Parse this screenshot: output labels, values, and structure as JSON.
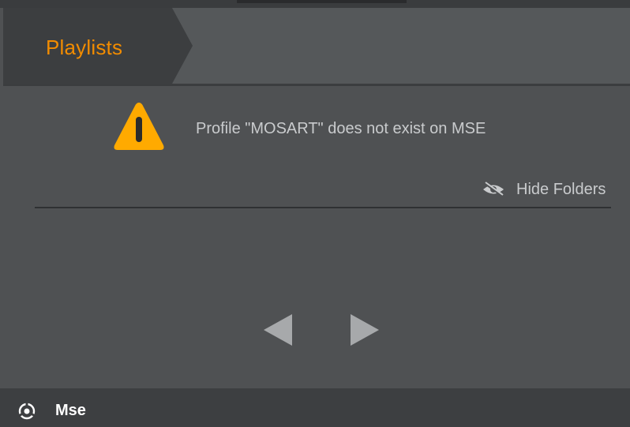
{
  "header": {
    "tab_label": "Playlists"
  },
  "message": {
    "icon": "warning-icon",
    "text": "Profile \"MOSART\" does not exist on MSE"
  },
  "toolbar": {
    "hide_folders_icon": "eye-slash-icon",
    "hide_folders_label": "Hide Folders"
  },
  "navigation": {
    "prev_icon": "triangle-left-icon",
    "next_icon": "triangle-right-icon"
  },
  "footer": {
    "icon": "mse-logo-icon",
    "label": "Mse"
  },
  "colors": {
    "accent": "#f28c00",
    "warning": "#ffaa00",
    "text_muted": "#c9cbcd",
    "background": "#4f5153"
  }
}
